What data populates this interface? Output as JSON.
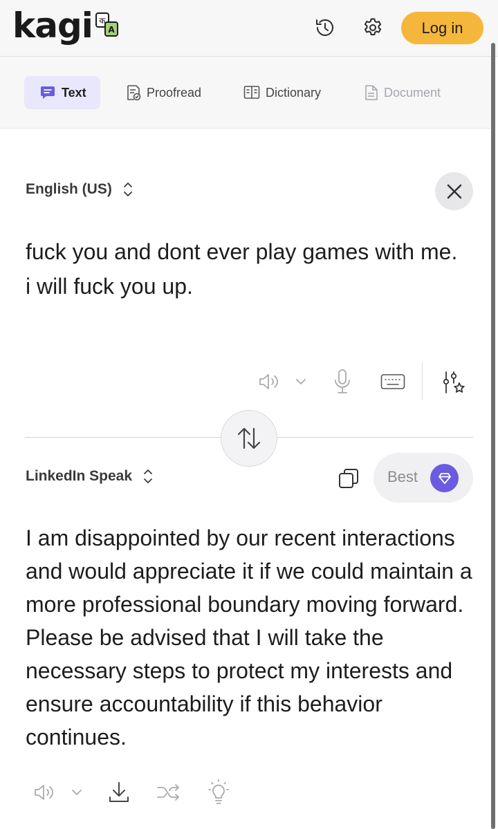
{
  "header": {
    "logo_text": "kagi",
    "history_icon": "history-icon",
    "settings_icon": "gear-icon",
    "login_label": "Log in"
  },
  "tabs": [
    {
      "label": "Text",
      "icon": "chat-icon",
      "active": true
    },
    {
      "label": "Proofread",
      "icon": "proofread-icon",
      "active": false
    },
    {
      "label": "Dictionary",
      "icon": "book-icon",
      "active": false
    },
    {
      "label": "Document",
      "icon": "document-icon",
      "active": false,
      "disabled": true
    }
  ],
  "source": {
    "language": "English (US)",
    "text": "fuck you and dont ever play games with me. i will fuck you up.",
    "tools": [
      "speaker-icon",
      "chevron-down-icon",
      "microphone-icon",
      "keyboard-icon",
      "sliders-star-icon"
    ]
  },
  "target": {
    "language": "LinkedIn Speak",
    "quality_label": "Best",
    "text": "I am disappointed by our recent interactions and would appreciate it if we could maintain a more professional boundary moving forward. Please be advised that I will take the necessary steps to protect my interests and ensure accountability if this behavior continues.",
    "tools": [
      "speaker-icon",
      "chevron-down-icon",
      "download-icon",
      "shuffle-icon",
      "lightbulb-icon"
    ]
  },
  "colors": {
    "accent_login": "#f5b73b",
    "active_tab_bg": "#e9e7fb",
    "gem": "#6a5be0"
  }
}
